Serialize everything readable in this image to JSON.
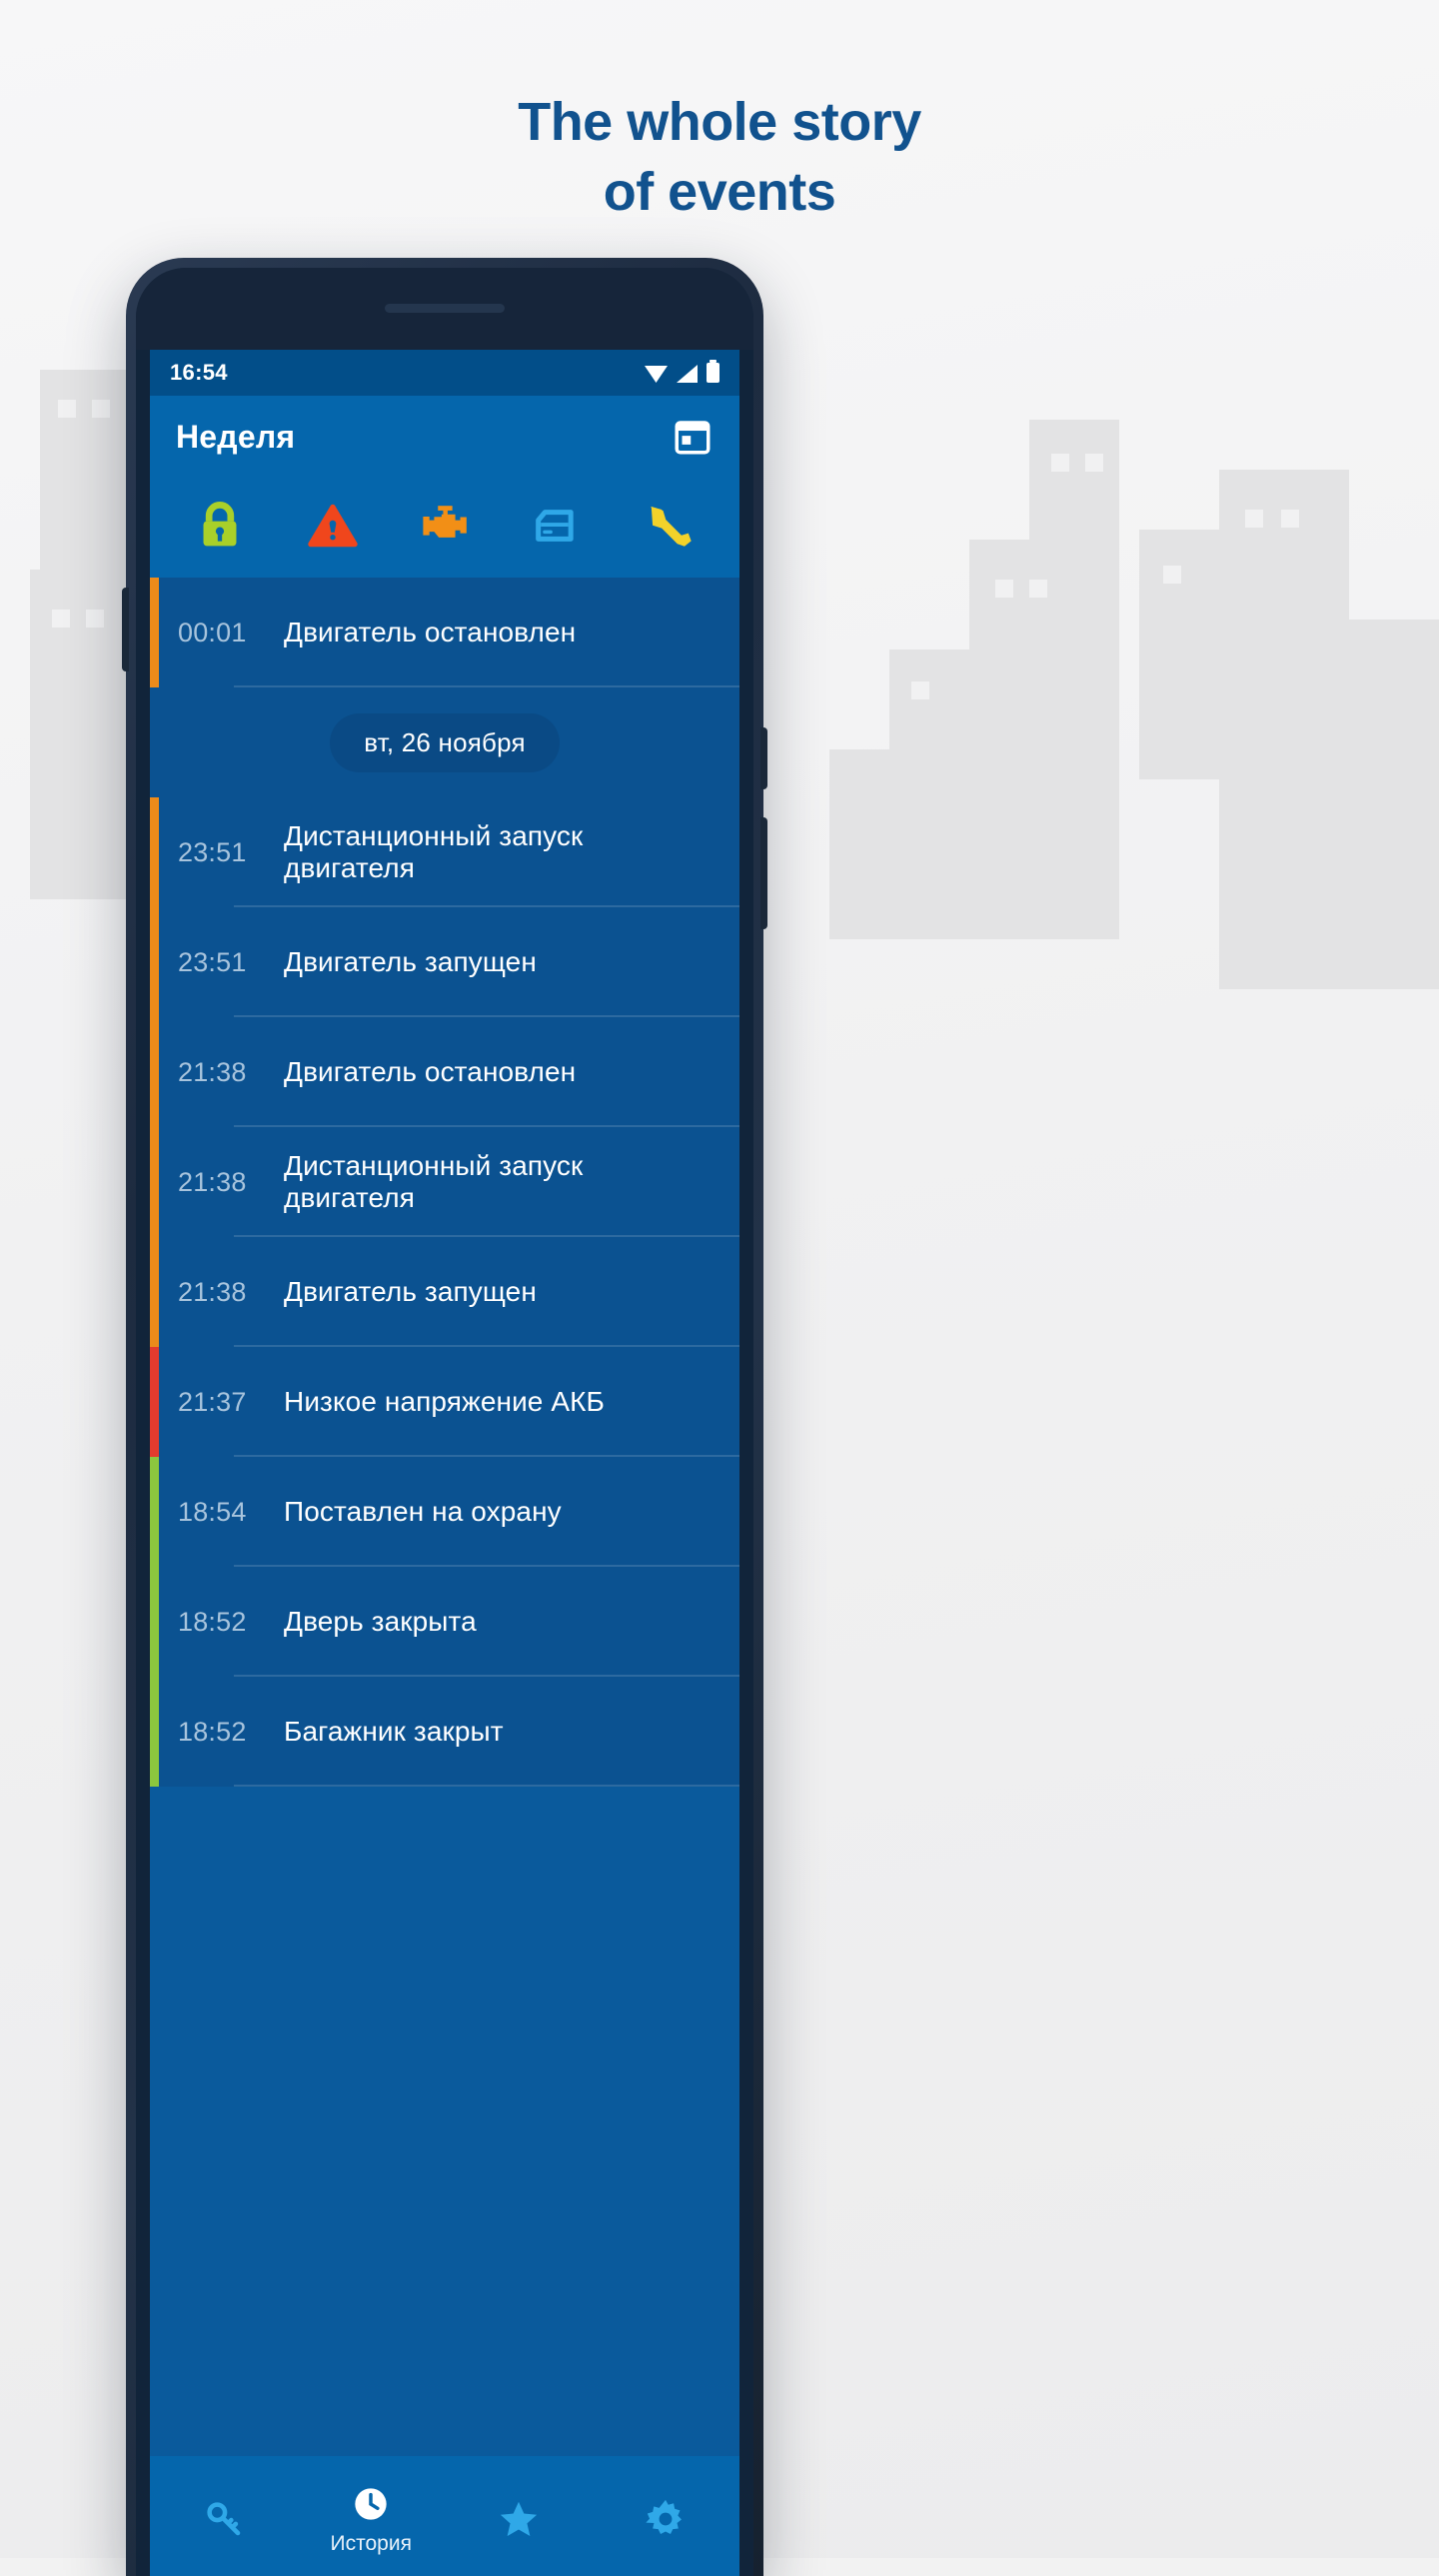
{
  "headline": {
    "line1": "The whole story",
    "line2": "of events",
    "color": "#11528e"
  },
  "status_bar": {
    "time": "16:54",
    "icons": [
      "wifi-icon",
      "signal-icon",
      "battery-icon"
    ],
    "background": "#024e89"
  },
  "app_bar": {
    "title": "Неделя",
    "action_icon": "calendar-icon",
    "background": "#0566ac"
  },
  "filter_bar": {
    "items": [
      {
        "name": "lock-icon",
        "color": "#a9d029"
      },
      {
        "name": "warning-icon",
        "color": "#f0461c"
      },
      {
        "name": "engine-icon",
        "color": "#f28f16"
      },
      {
        "name": "door-icon",
        "color": "#2fa8e8"
      },
      {
        "name": "wrench-icon",
        "color": "#f3d22a"
      }
    ]
  },
  "events": [
    {
      "time": "00:01",
      "title": "Двигатель остановлен",
      "accent": "#ec8b1a"
    },
    {
      "time": "23:51",
      "title": "Дистанционный запуск двигателя",
      "accent": "#ec8b1a"
    },
    {
      "time": "23:51",
      "title": "Двигатель запущен",
      "accent": "#ec8b1a"
    },
    {
      "time": "21:38",
      "title": "Двигатель остановлен",
      "accent": "#ec8b1a"
    },
    {
      "time": "21:38",
      "title": "Дистанционный запуск двигателя",
      "accent": "#ec8b1a"
    },
    {
      "time": "21:38",
      "title": "Двигатель запущен",
      "accent": "#ec8b1a"
    },
    {
      "time": "21:37",
      "title": "Низкое напряжение АКБ",
      "accent": "#e33b2e"
    },
    {
      "time": "18:54",
      "title": "Поставлен на охрану",
      "accent": "#8cc63e"
    },
    {
      "time": "18:52",
      "title": "Дверь закрыта",
      "accent": "#8cc63e"
    },
    {
      "time": "18:52",
      "title": "Багажник закрыт",
      "accent": "#8cc63e"
    }
  ],
  "date_chip": {
    "label": "вт, 26 ноября",
    "after_index": 0
  },
  "bottom_nav": {
    "items": [
      {
        "name": "key-icon",
        "label": "",
        "active": false
      },
      {
        "name": "history-icon",
        "label": "История",
        "active": true
      },
      {
        "name": "star-icon",
        "label": "",
        "active": false
      },
      {
        "name": "settings-icon",
        "label": "",
        "active": false
      }
    ]
  }
}
